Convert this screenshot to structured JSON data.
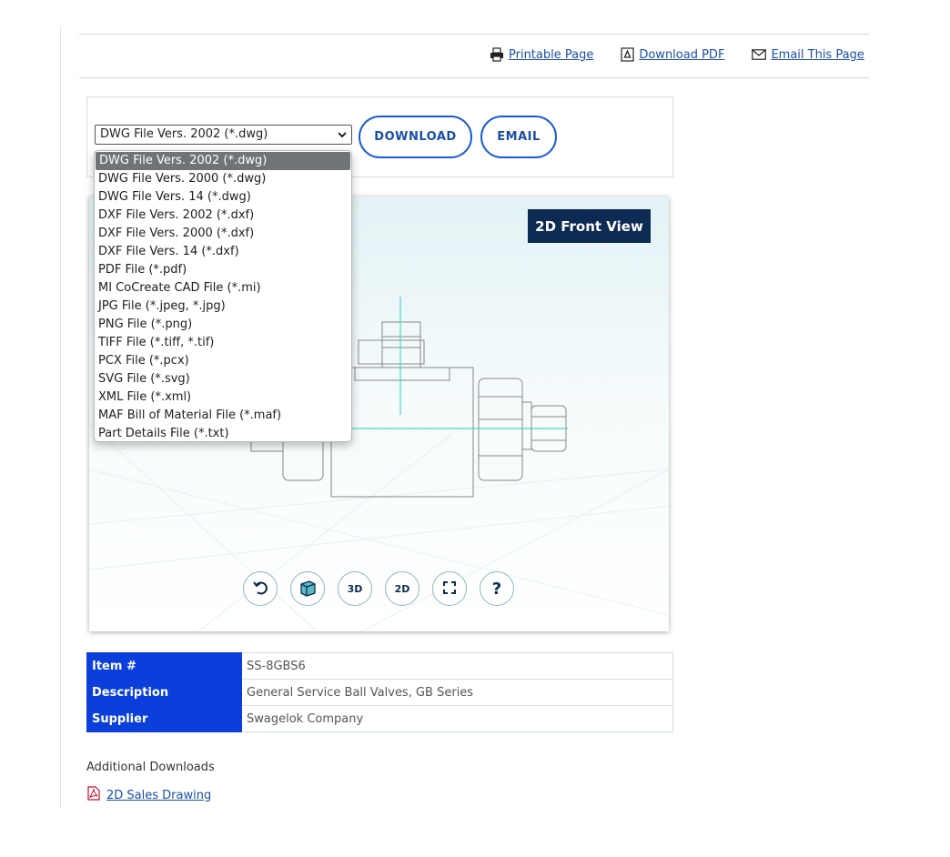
{
  "toolbar": {
    "printable_label": "Printable Page",
    "download_pdf_label": "Download PDF",
    "email_page_label": "Email This Page"
  },
  "download": {
    "selected_format": "DWG File Vers. 2002 (*.dwg)",
    "download_label": "DOWNLOAD",
    "email_label": "EMAIL",
    "options": [
      "DWG File Vers. 2002 (*.dwg)",
      "DWG File Vers. 2000 (*.dwg)",
      "DWG File Vers. 14 (*.dwg)",
      "DXF File Vers. 2002 (*.dxf)",
      "DXF File Vers. 2000 (*.dxf)",
      "DXF File Vers. 14 (*.dxf)",
      "PDF File (*.pdf)",
      "MI CoCreate CAD File (*.mi)",
      "JPG File (*.jpeg, *.jpg)",
      "PNG File (*.png)",
      "TIFF File (*.tiff, *.tif)",
      "PCX File (*.pcx)",
      "SVG File (*.svg)",
      "XML File (*.xml)",
      "MAF Bill of Material File (*.maf)",
      "Part Details File (*.txt)"
    ]
  },
  "viewer": {
    "view_label": "2D Front View",
    "controls": [
      {
        "name": "reset-view-icon",
        "label": ""
      },
      {
        "name": "cube-icon",
        "label": ""
      },
      {
        "name": "3d-view-button",
        "label": "3D"
      },
      {
        "name": "2d-view-button",
        "label": "2D"
      },
      {
        "name": "fullscreen-icon",
        "label": ""
      },
      {
        "name": "help-icon",
        "label": "?"
      }
    ]
  },
  "details": {
    "rows": [
      {
        "key": "Item #",
        "value": "SS-8GBS6"
      },
      {
        "key": "Description",
        "value": "General Service Ball Valves, GB Series"
      },
      {
        "key": "Supplier",
        "value": "Swagelok Company"
      }
    ]
  },
  "additional": {
    "title": "Additional Downloads",
    "link_label": "2D Sales Drawing"
  },
  "colors": {
    "accent": "#0a3fdc",
    "link": "#1a4ea8",
    "label_bg": "#0d2b52",
    "control_border": "#8ab8bf"
  }
}
